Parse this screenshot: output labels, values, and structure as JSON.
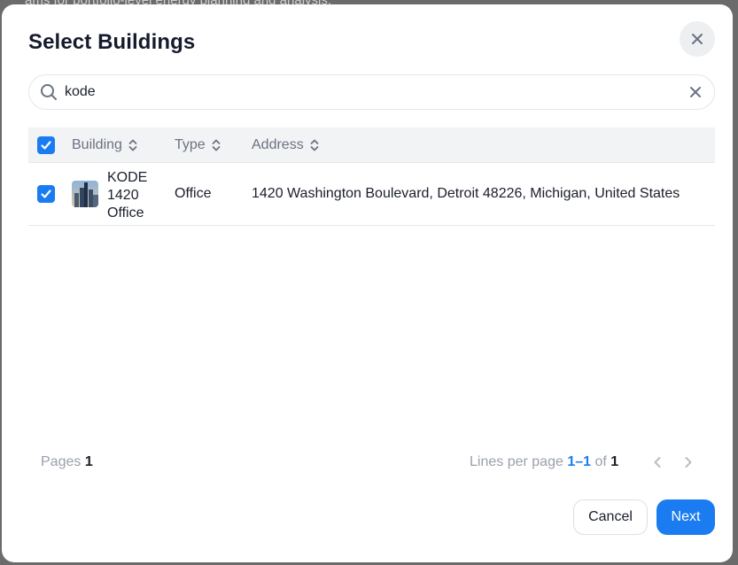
{
  "backdrop": {
    "text": "ams for portfolio-level energy planning and analysis."
  },
  "dialog": {
    "title": "Select Buildings",
    "close_icon": "close-icon"
  },
  "search": {
    "value": "kode",
    "placeholder": "",
    "icon": "search-icon",
    "clear_icon": "close-icon"
  },
  "table": {
    "columns": [
      {
        "label": "Building",
        "icon": "sort-icon"
      },
      {
        "label": "Type",
        "icon": "sort-icon"
      },
      {
        "label": "Address",
        "icon": "sort-icon"
      }
    ],
    "rows": [
      {
        "checked": true,
        "thumbnail_icon": "building-image",
        "name": "KODE 1420 Office",
        "type": "Office",
        "address": "1420 Washington Boulevard, Detroit 48226, Michigan, United States"
      }
    ],
    "select_all_checked": true
  },
  "pagination": {
    "pages_label": "Pages",
    "pages_value": "1",
    "lines_label": "Lines per page",
    "range": "1–1",
    "of_label": "of",
    "total": "1",
    "prev_icon": "chevron-left-icon",
    "next_icon": "chevron-right-icon"
  },
  "actions": {
    "cancel_label": "Cancel",
    "next_label": "Next"
  },
  "colors": {
    "accent": "#1a7cf0",
    "title_text": "#151a2d",
    "muted_text": "#9aa0ab",
    "header_bg": "#f2f3f5"
  }
}
